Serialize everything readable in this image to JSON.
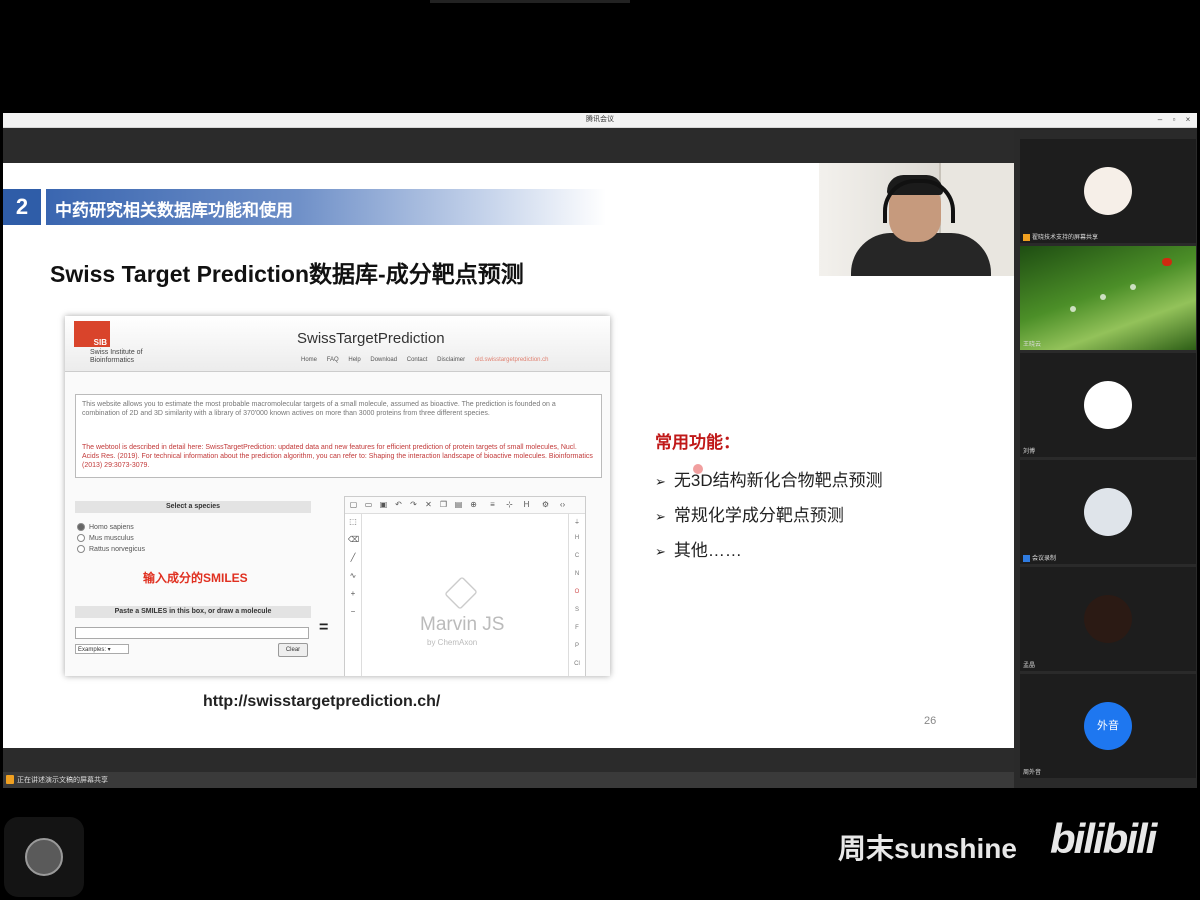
{
  "window": {
    "title": "腾讯会议",
    "controls": [
      "–",
      "▫",
      "×"
    ]
  },
  "share_strip": {
    "text": "正在讲述演示文稿的屏幕共享"
  },
  "slide": {
    "section_number": "2",
    "section_title": "中药研究相关数据库功能和使用",
    "title": "Swiss Target Prediction数据库-成分靶点预测",
    "url": "http://swisstargetprediction.ch/",
    "page_number": "26",
    "functions_title": "常用功能：",
    "functions": [
      "无3D结构新化合物靶点预测",
      "常规化学成分靶点预测",
      "其他……"
    ]
  },
  "website": {
    "logo": "SIB",
    "org_name_line1": "Swiss Institute of",
    "org_name_line2": "Bioinformatics",
    "brand": "SwissTargetPrediction",
    "nav": [
      "Home",
      "FAQ",
      "Help",
      "Download",
      "Contact",
      "Disclaimer"
    ],
    "nav_extra": "old.swisstargetprediction.ch",
    "intro": "This website allows you to estimate the most probable macromolecular targets of a small molecule, assumed as bioactive. The prediction is founded on a combination of 2D and 3D similarity with a library of 370'000 known actives on more than 3000 proteins from three different species.",
    "reference": "The webtool is described in detail here: SwissTargetPrediction: updated data and new features for efficient prediction of protein targets of small molecules, Nucl. Acids Res. (2019). For technical information about the prediction algorithm, you can refer to: Shaping the interaction landscape of bioactive molecules. Bioinformatics (2013) 29:3073-3079.",
    "species_header": "Select a species",
    "species": [
      "Homo sapiens",
      "Mus musculus",
      "Rattus norvegicus"
    ],
    "selected_species": "Homo sapiens",
    "annotation": "输入成分的SMILES",
    "smiles_header": "Paste a SMILES in this box, or draw a molecule",
    "examples_label": "Examples:",
    "clear_label": "Clear",
    "equals": "=",
    "editor_name": "Marvin JS",
    "editor_by": "by ChemAxon",
    "element_buttons": [
      "H",
      "C",
      "N",
      "O",
      "S",
      "F",
      "P",
      "Cl"
    ]
  },
  "participants": [
    {
      "name": "翟晓技术支持的屏幕共享",
      "avatar": "rabbit-avatar",
      "host": true
    },
    {
      "name": "王晓云",
      "avatar": "leaf-photo"
    },
    {
      "name": "刘博",
      "avatar": "dog-avatar"
    },
    {
      "name": "会议录制",
      "avatar": "child-photo"
    },
    {
      "name": "孟晶",
      "avatar": "planet-avatar"
    },
    {
      "name": "周外音",
      "avatar": "外音"
    }
  ],
  "watermark": {
    "uploader": "周末sunshine",
    "platform": "bilibili"
  },
  "colors": {
    "section_blue": "#2f5da8",
    "accent_red": "#c01818",
    "annotation_red": "#e03020",
    "avatar_blue": "#1e77f0",
    "host_badge": "#f0a020"
  }
}
